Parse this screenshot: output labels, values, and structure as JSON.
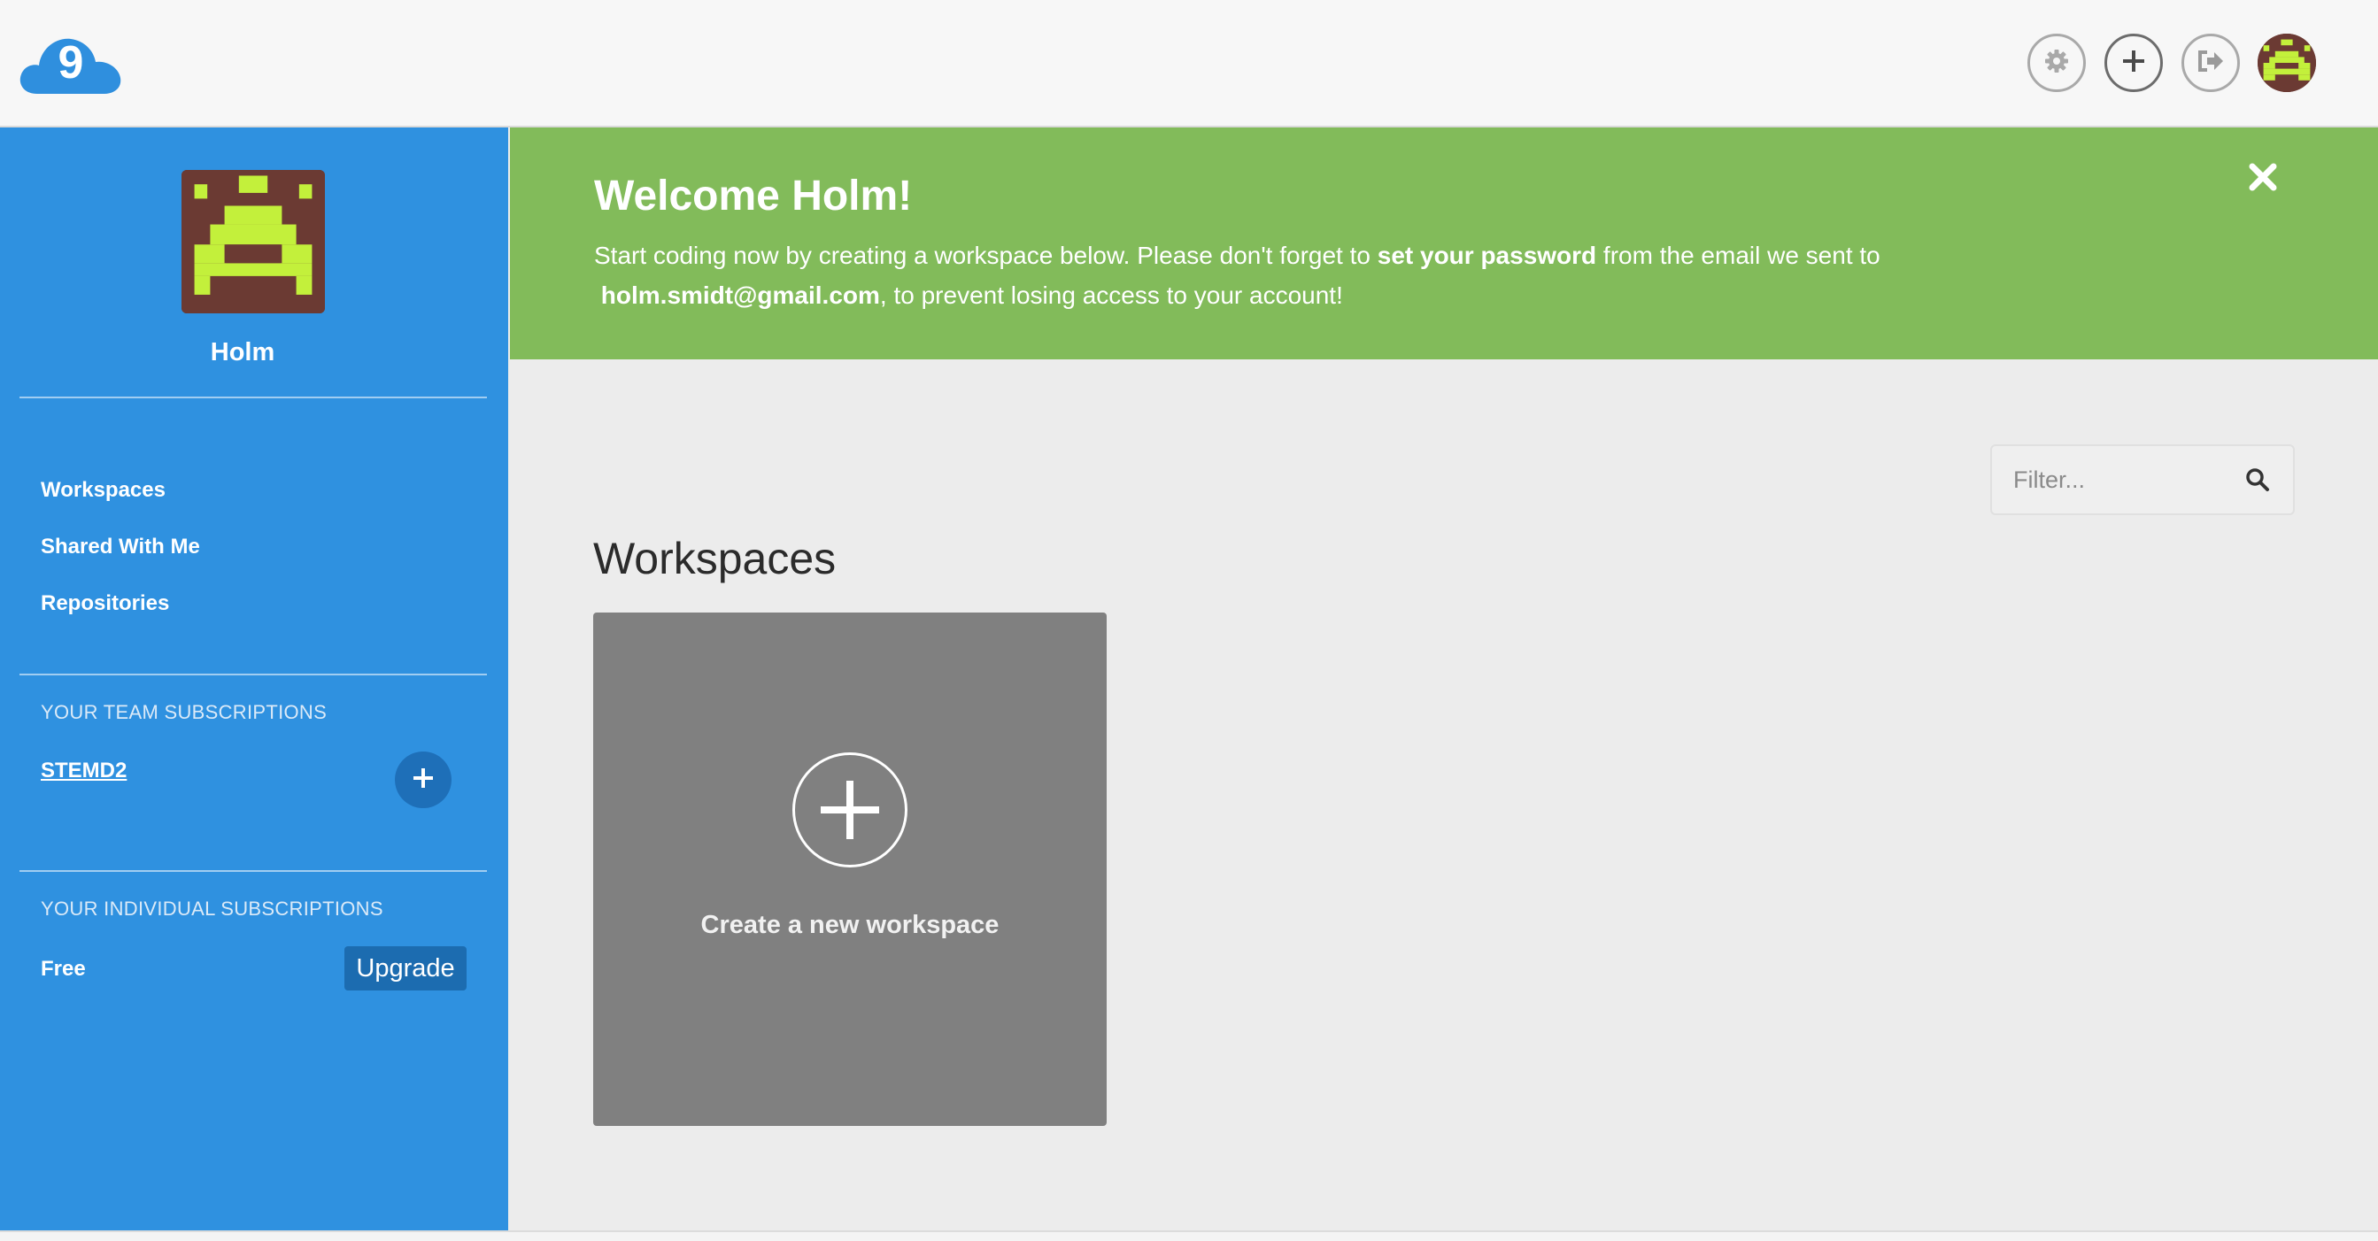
{
  "header": {
    "logo_icon": "cloud9-logo-icon",
    "logo_glyph": "9",
    "buttons": [
      {
        "name": "settings-button",
        "icon": "gear-icon"
      },
      {
        "name": "create-button",
        "icon": "plus-icon"
      },
      {
        "name": "logout-button",
        "icon": "sign-out-icon"
      }
    ],
    "avatar_icon": "space-invader-avatar"
  },
  "sidebar": {
    "user_name": "Holm",
    "nav": [
      "Workspaces",
      "Shared With Me",
      "Repositories"
    ],
    "team_section_title": "YOUR TEAM SUBSCRIPTIONS",
    "team_name": "STEMD2",
    "individual_section_title": "YOUR INDIVIDUAL SUBSCRIPTIONS",
    "plan": "Free",
    "upgrade_label": "Upgrade"
  },
  "banner": {
    "title": "Welcome Holm!",
    "text_part1": "Start coding now by creating a workspace below. Please don't forget to ",
    "text_bold1": "set your password",
    "text_part2": " from the email we sent to ",
    "email": "holm.smidt@gmail.com",
    "text_part3": ", to prevent losing access to your account!",
    "close_icon": "close-icon"
  },
  "main": {
    "filter_placeholder": "Filter...",
    "section_title": "Workspaces",
    "create_label": "Create a new workspace"
  },
  "colors": {
    "sidebar": "#2f91e0",
    "banner": "#82bb5a",
    "avatar_bg": "#6b3a33",
    "avatar_fg": "#c3f03b",
    "card": "#808080"
  }
}
